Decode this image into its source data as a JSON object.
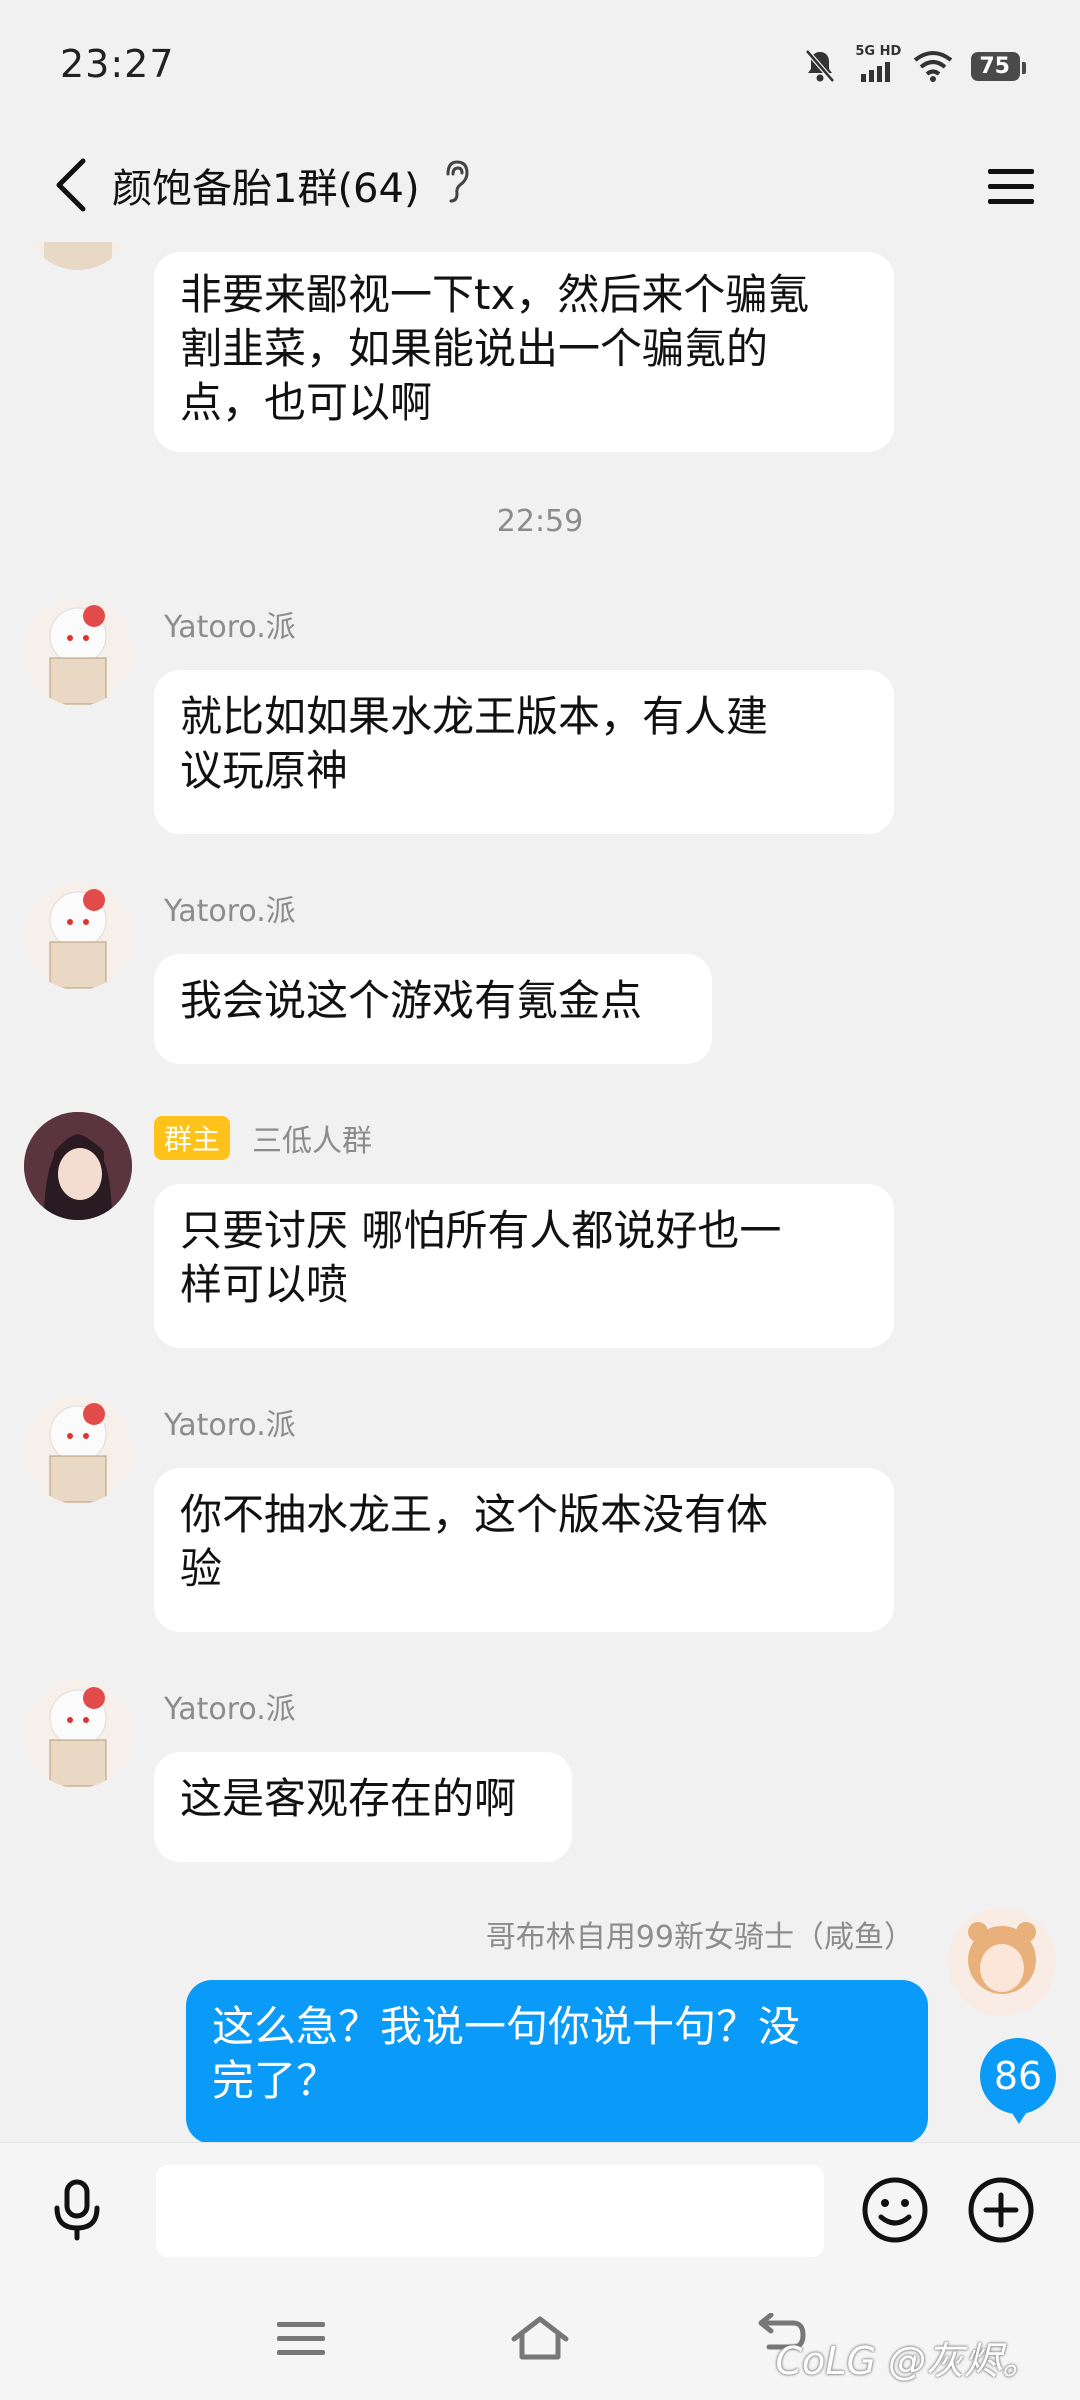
{
  "status_bar": {
    "time": "23:27",
    "network_label": "5G HD",
    "battery": "75"
  },
  "header": {
    "title": "颜饱备胎1群(64)"
  },
  "messages": [
    {
      "sender": "",
      "lines": [
        "非要来鄙视一下tx，然后来个骗氪",
        "割韭菜，如果能说出一个骗氪的",
        "点，也可以啊"
      ]
    },
    {
      "timestamp": "22:59"
    },
    {
      "sender": "Yatoro.派",
      "lines": [
        "就比如如果水龙王版本，有人建",
        "议玩原神"
      ]
    },
    {
      "sender": "Yatoro.派",
      "lines": [
        "我会说这个游戏有氪金点"
      ]
    },
    {
      "badge": "群主",
      "sender": "三低人群",
      "lines": [
        "只要讨厌 哪怕所有人都说好也一",
        "样可以喷"
      ]
    },
    {
      "sender": "Yatoro.派",
      "lines": [
        "你不抽水龙王，这个版本没有体",
        "验"
      ]
    },
    {
      "sender": "Yatoro.派",
      "lines": [
        "这是客观存在的啊"
      ]
    },
    {
      "sender": "哥布林自用99新女骑士（咸鱼）",
      "lines": [
        "这么急？我说一句你说十句？没",
        "完了？"
      ],
      "self": true
    }
  ],
  "unread_count": "86",
  "input": {
    "placeholder": ""
  },
  "watermark": "CoLG @灰烬。",
  "colors": {
    "background": "#f1f1f1",
    "self_bubble": "#0a9af7",
    "owner_badge": "#ffc21a"
  }
}
